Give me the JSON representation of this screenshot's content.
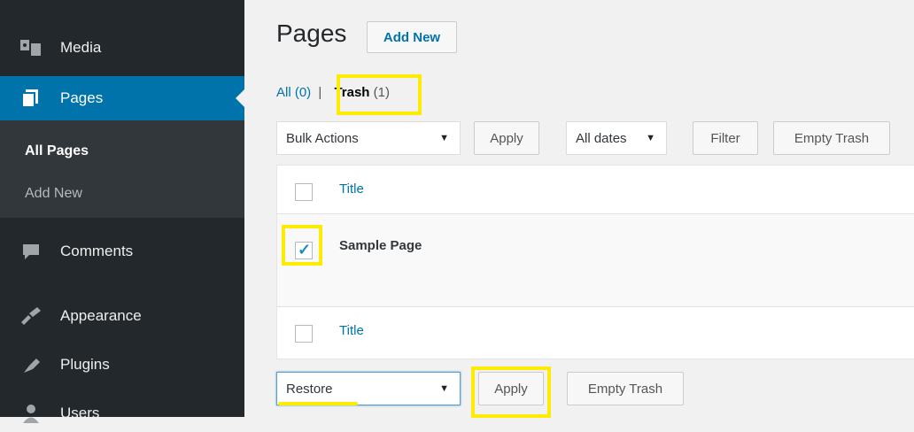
{
  "sidebar": {
    "items": [
      {
        "label": "Media",
        "icon": "media-icon"
      },
      {
        "label": "Pages",
        "icon": "pages-icon",
        "current": true
      },
      {
        "label": "Comments",
        "icon": "comments-icon"
      },
      {
        "label": "Appearance",
        "icon": "appearance-icon"
      },
      {
        "label": "Plugins",
        "icon": "plugins-icon"
      },
      {
        "label": "Users",
        "icon": "users-icon"
      }
    ],
    "submenu": [
      {
        "label": "All Pages",
        "current": true
      },
      {
        "label": "Add New"
      }
    ]
  },
  "header": {
    "title": "Pages",
    "add_new_label": "Add New"
  },
  "filters": {
    "all_label": "All",
    "all_count": "(0)",
    "separator": "|",
    "trash_label": "Trash",
    "trash_count": "(1)"
  },
  "top_actions": {
    "bulk_select": "Bulk Actions",
    "apply_label": "Apply",
    "dates_select": "All dates",
    "filter_label": "Filter",
    "empty_trash_label": "Empty Trash"
  },
  "table": {
    "header_title": "Title",
    "rows": [
      {
        "title": "Sample Page",
        "checked": true
      }
    ],
    "footer_title": "Title"
  },
  "bottom_actions": {
    "bulk_select": "Restore",
    "apply_label": "Apply",
    "empty_trash_label": "Empty Trash"
  },
  "colors": {
    "sidebar_bg": "#23282d",
    "active_bg": "#0073aa",
    "highlight": "#ffeb00",
    "link": "#0073aa"
  }
}
